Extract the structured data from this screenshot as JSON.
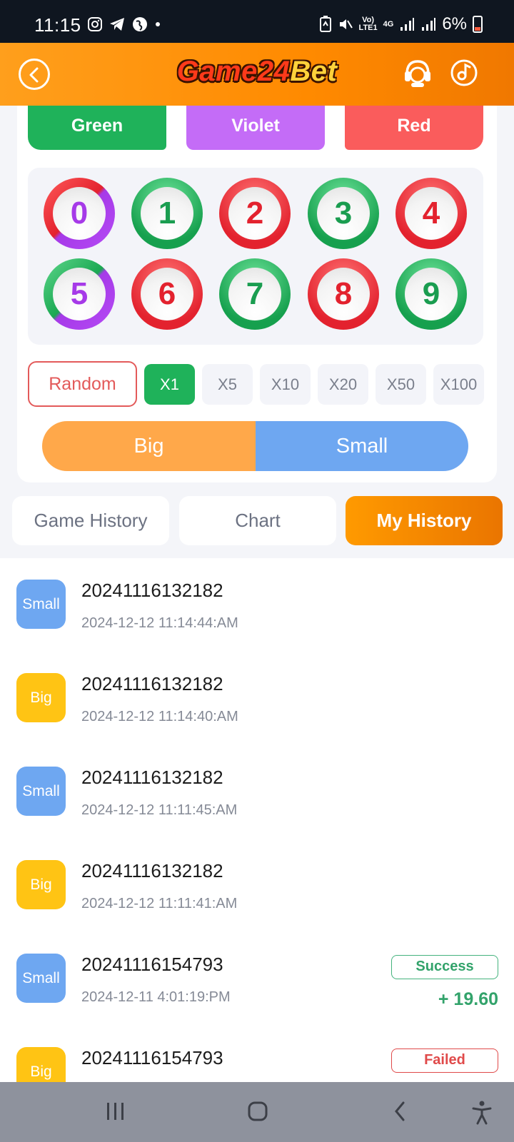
{
  "status_bar": {
    "time": "11:15",
    "net_top": "Vo)",
    "net_bottom": "LTE1",
    "gen": "4G",
    "battery": "6%"
  },
  "header": {
    "logo_main": "Game24",
    "logo_accent": "Bet"
  },
  "colors": {
    "accent": "#ff8a00",
    "green": "#1fb25a",
    "violet": "#c46cf7",
    "red": "#fa5c5c",
    "big": "#ffa84a",
    "small": "#6ea7f1"
  },
  "color_buttons": {
    "green": "Green",
    "violet": "Violet",
    "red": "Red"
  },
  "balls": [
    "0",
    "1",
    "2",
    "3",
    "4",
    "5",
    "6",
    "7",
    "8",
    "9"
  ],
  "random_label": "Random",
  "multipliers": [
    "X1",
    "X5",
    "X10",
    "X20",
    "X50",
    "X100"
  ],
  "big_label": "Big",
  "small_label": "Small",
  "tabs": [
    "Game History",
    "Chart",
    "My History"
  ],
  "history": [
    {
      "type": "Small",
      "period": "20241116132182",
      "date": "2024-12-12 11:14:44:AM",
      "status": "",
      "amount": ""
    },
    {
      "type": "Big",
      "period": "20241116132182",
      "date": "2024-12-12 11:14:40:AM",
      "status": "",
      "amount": ""
    },
    {
      "type": "Small",
      "period": "20241116132182",
      "date": "2024-12-12 11:11:45:AM",
      "status": "",
      "amount": ""
    },
    {
      "type": "Big",
      "period": "20241116132182",
      "date": "2024-12-12 11:11:41:AM",
      "status": "",
      "amount": ""
    },
    {
      "type": "Small",
      "period": "20241116154793",
      "date": "2024-12-11 4:01:19:PM",
      "status": "Success",
      "amount": "+ 19.60"
    },
    {
      "type": "Big",
      "period": "20241116154793",
      "date": "",
      "status": "Failed",
      "amount": ""
    }
  ]
}
